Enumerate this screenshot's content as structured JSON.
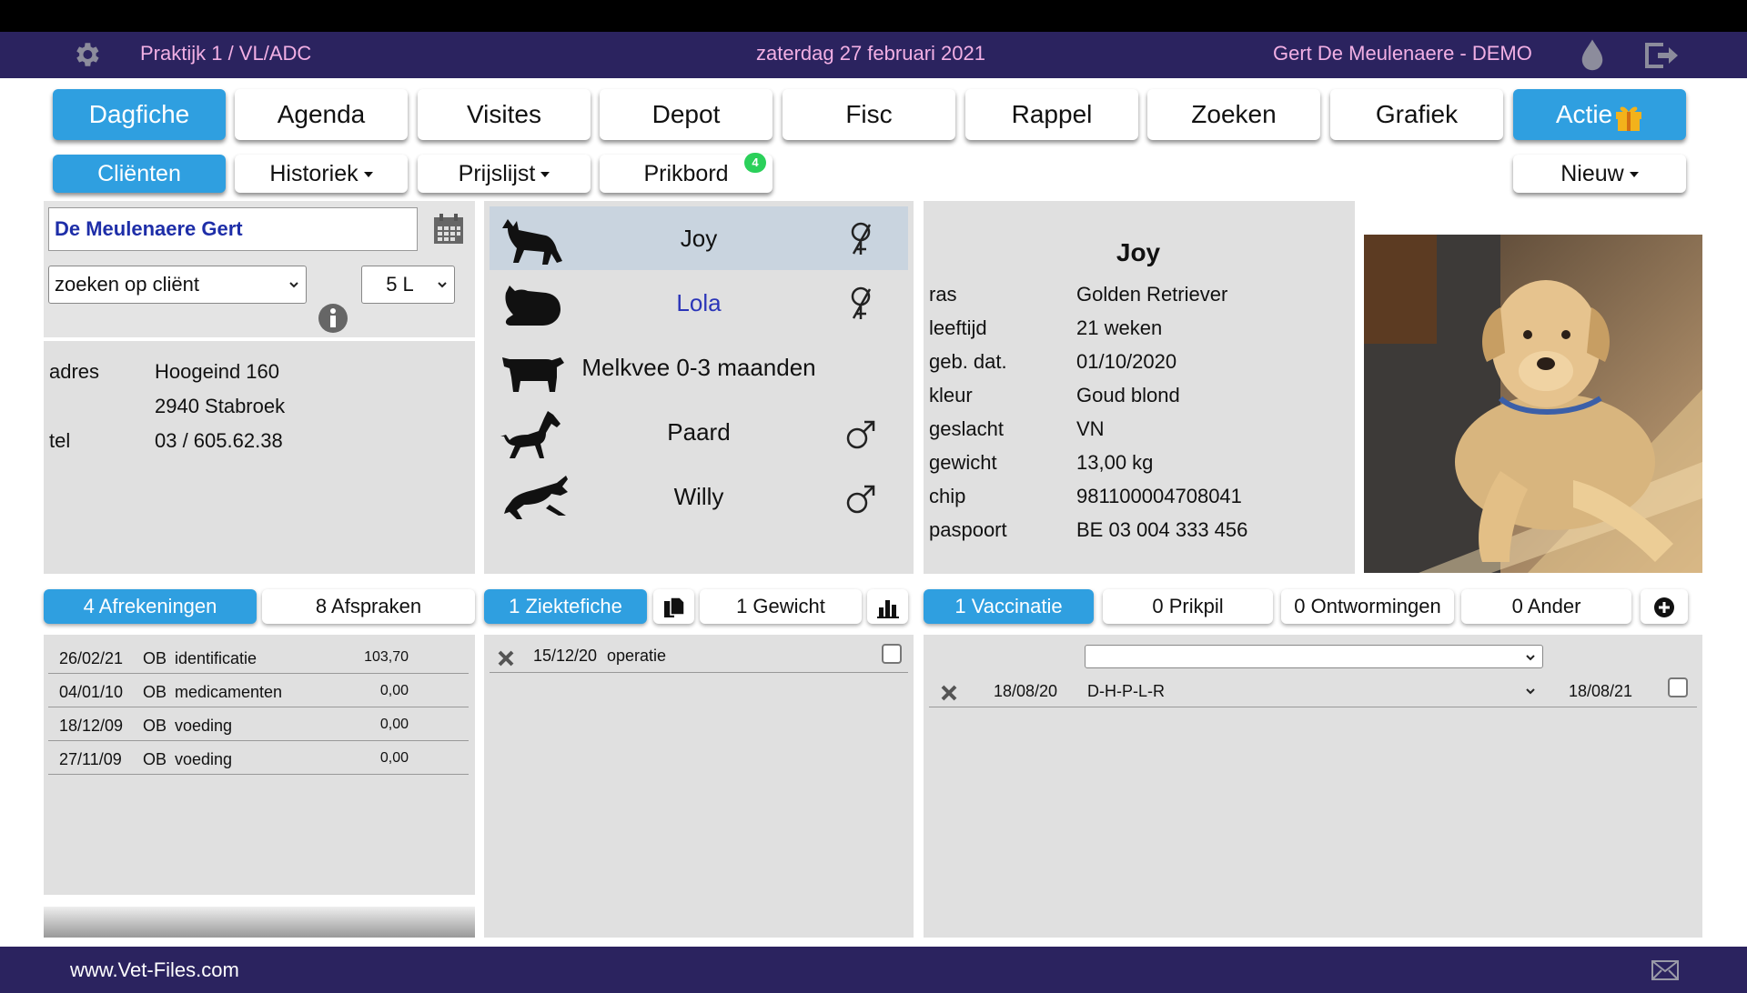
{
  "header": {
    "practice": "Praktijk 1 / VL/ADC",
    "date": "zaterdag 27 februari 2021",
    "user": "Gert De Meulenaere - DEMO"
  },
  "nav": [
    {
      "label": "Dagfiche",
      "active": true
    },
    {
      "label": "Agenda"
    },
    {
      "label": "Visites"
    },
    {
      "label": "Depot"
    },
    {
      "label": "Fisc"
    },
    {
      "label": "Rappel"
    },
    {
      "label": "Zoeken"
    },
    {
      "label": "Grafiek"
    },
    {
      "label": "Actie",
      "active": true
    }
  ],
  "subnav": {
    "clienten": "Cliënten",
    "historiek": "Historiek",
    "prijslijst": "Prijslijst",
    "prikbord": "Prikbord",
    "prikbord_badge": "4",
    "nieuw": "Nieuw"
  },
  "client": {
    "name": "De Meulenaere Gert",
    "search_mode": "zoeken op cliënt",
    "size": "5 L",
    "adres_label": "adres",
    "street": "Hoogeind 160",
    "city": "2940 Stabroek",
    "tel_label": "tel",
    "tel": "03 / 605.62.38"
  },
  "pets": [
    {
      "name": "Joy",
      "animal": "dog-icon",
      "sex": "female-neutered-icon",
      "selected": true
    },
    {
      "name": "Lola",
      "animal": "cat-icon",
      "sex": "female-neutered-icon",
      "highlight": "#2b35b8"
    },
    {
      "name": "Melkvee 0-3 maanden",
      "animal": "cow-icon",
      "sex": ""
    },
    {
      "name": "Paard",
      "animal": "horse-icon",
      "sex": "male-icon"
    },
    {
      "name": "Willy",
      "animal": "rabbit-icon",
      "sex": "male-icon"
    }
  ],
  "pet_detail": {
    "title": "Joy",
    "fields": [
      {
        "k": "ras",
        "v": "Golden Retriever"
      },
      {
        "k": "leeftijd",
        "v": "21 weken"
      },
      {
        "k": "geb. dat.",
        "v": "01/10/2020"
      },
      {
        "k": "kleur",
        "v": "Goud blond"
      },
      {
        "k": "geslacht",
        "v": "VN"
      },
      {
        "k": "gewicht",
        "v": "13,00 kg"
      },
      {
        "k": "chip",
        "v": "981100004708041"
      },
      {
        "k": "paspoort",
        "v": "BE 03 004 333 456"
      }
    ]
  },
  "tabs": {
    "afrekeningen": "4 Afrekeningen",
    "afspraken": "8 Afspraken",
    "ziektefiche": "1 Ziektefiche",
    "gewicht": "1 Gewicht",
    "vaccinatie": "1 Vaccinatie",
    "prikpil": "0 Prikpil",
    "ontwormingen": "0 Ontwormingen",
    "ander": "0 Ander"
  },
  "afrekeningen": [
    {
      "date": "26/02/21",
      "code": "OB",
      "desc": "identificatie",
      "amount": "103,70"
    },
    {
      "date": "04/01/10",
      "code": "OB",
      "desc": "medicamenten",
      "amount": "0,00"
    },
    {
      "date": "18/12/09",
      "code": "OB",
      "desc": "voeding",
      "amount": "0,00"
    },
    {
      "date": "27/11/09",
      "code": "OB",
      "desc": "voeding",
      "amount": "0,00"
    }
  ],
  "ziektefiche": [
    {
      "date": "15/12/20",
      "desc": "operatie"
    }
  ],
  "vaccinaties": [
    {
      "date": "18/08/20",
      "vaccine": "D-H-P-L-R",
      "next": "18/08/21"
    }
  ],
  "footer": {
    "site": "www.Vet-Files.com"
  },
  "colors": {
    "header_bg": "#2b235f",
    "accent": "#2f9fe0",
    "header_text": "#f2b0e4"
  }
}
